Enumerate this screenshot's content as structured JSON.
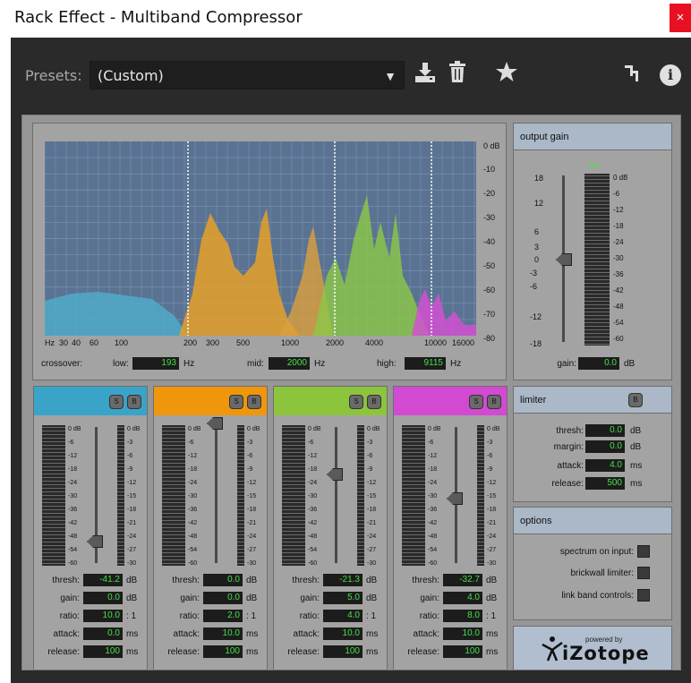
{
  "window": {
    "title": "Rack Effect - Multiband Compressor",
    "close": "×"
  },
  "presets": {
    "label": "Presets:",
    "value": "(Custom)"
  },
  "icons": {
    "save": "save-preset-icon",
    "delete": "trash-icon",
    "favorite": "star-icon",
    "routing": "routing-icon",
    "info": "info-icon"
  },
  "spectrum": {
    "db_labels": [
      "0 dB",
      "-10",
      "-20",
      "-30",
      "-40",
      "-50",
      "-60",
      "-70",
      "-80"
    ],
    "hz_labels": [
      "Hz",
      "30",
      "40",
      "60",
      "100",
      "200",
      "300",
      "500",
      "1000",
      "2000",
      "4000",
      "10000",
      "16000"
    ],
    "crossover_label": "crossover:",
    "low_label": "low:",
    "low_value": "193",
    "low_unit": "Hz",
    "mid_label": "mid:",
    "mid_value": "2000",
    "mid_unit": "Hz",
    "high_label": "high:",
    "high_value": "9115",
    "high_unit": "Hz"
  },
  "output_gain": {
    "header": "output gain",
    "scale": [
      "18",
      "12",
      "6",
      "3",
      "0",
      "-3",
      "-6",
      "-12",
      "-18"
    ],
    "meter_top": "-Inf",
    "meter_scale": [
      "0 dB",
      "-6",
      "-12",
      "-18",
      "-24",
      "-30",
      "-36",
      "-42",
      "-48",
      "-54",
      "-60"
    ],
    "gain_label": "gain:",
    "gain_value": "0.0",
    "gain_unit": "dB"
  },
  "band_meter_scale": [
    "0 dB",
    "-6",
    "-12",
    "-18",
    "-24",
    "-30",
    "-36",
    "-42",
    "-48",
    "-54",
    "-60"
  ],
  "band_gr_scale": [
    "0 dB",
    "-3",
    "-6",
    "-9",
    "-12",
    "-15",
    "-18",
    "-21",
    "-24",
    "-27",
    "-30"
  ],
  "band_params": {
    "thresh": "thresh:",
    "gain": "gain:",
    "ratio": "ratio:",
    "attack": "attack:",
    "release": "release:"
  },
  "band_units": {
    "thresh": "dB",
    "gain": "dB",
    "ratio": ": 1",
    "attack": "ms",
    "release": "ms"
  },
  "solo": "S",
  "bypass": "B",
  "bands": [
    {
      "color": "#3aa4c8",
      "thresh": "-41.2",
      "gain": "0.0",
      "ratio": "10.0",
      "attack": "0.0",
      "release": "100"
    },
    {
      "color": "#f0960a",
      "thresh": "0.0",
      "gain": "0.0",
      "ratio": "2.0",
      "attack": "10.0",
      "release": "100"
    },
    {
      "color": "#8cc43c",
      "thresh": "-21.3",
      "gain": "5.0",
      "ratio": "4.0",
      "attack": "10.0",
      "release": "100"
    },
    {
      "color": "#d24ad2",
      "thresh": "-32.7",
      "gain": "4.0",
      "ratio": "8.0",
      "attack": "10.0",
      "release": "100"
    }
  ],
  "limiter": {
    "header": "limiter",
    "bypass": "B",
    "thresh_label": "thresh:",
    "thresh_value": "0.0",
    "thresh_unit": "dB",
    "margin_label": "margin:",
    "margin_value": "0.0",
    "margin_unit": "dB",
    "attack_label": "attack:",
    "attack_value": "4.0",
    "attack_unit": "ms",
    "release_label": "release:",
    "release_value": "500",
    "release_unit": "ms"
  },
  "options": {
    "header": "options",
    "spectrum_on_input": "spectrum on input:",
    "brickwall_limiter": "brickwall limiter:",
    "link_band_controls": "link band controls:"
  },
  "logo": {
    "powered_by": "powered by",
    "brand": "iZotope"
  }
}
